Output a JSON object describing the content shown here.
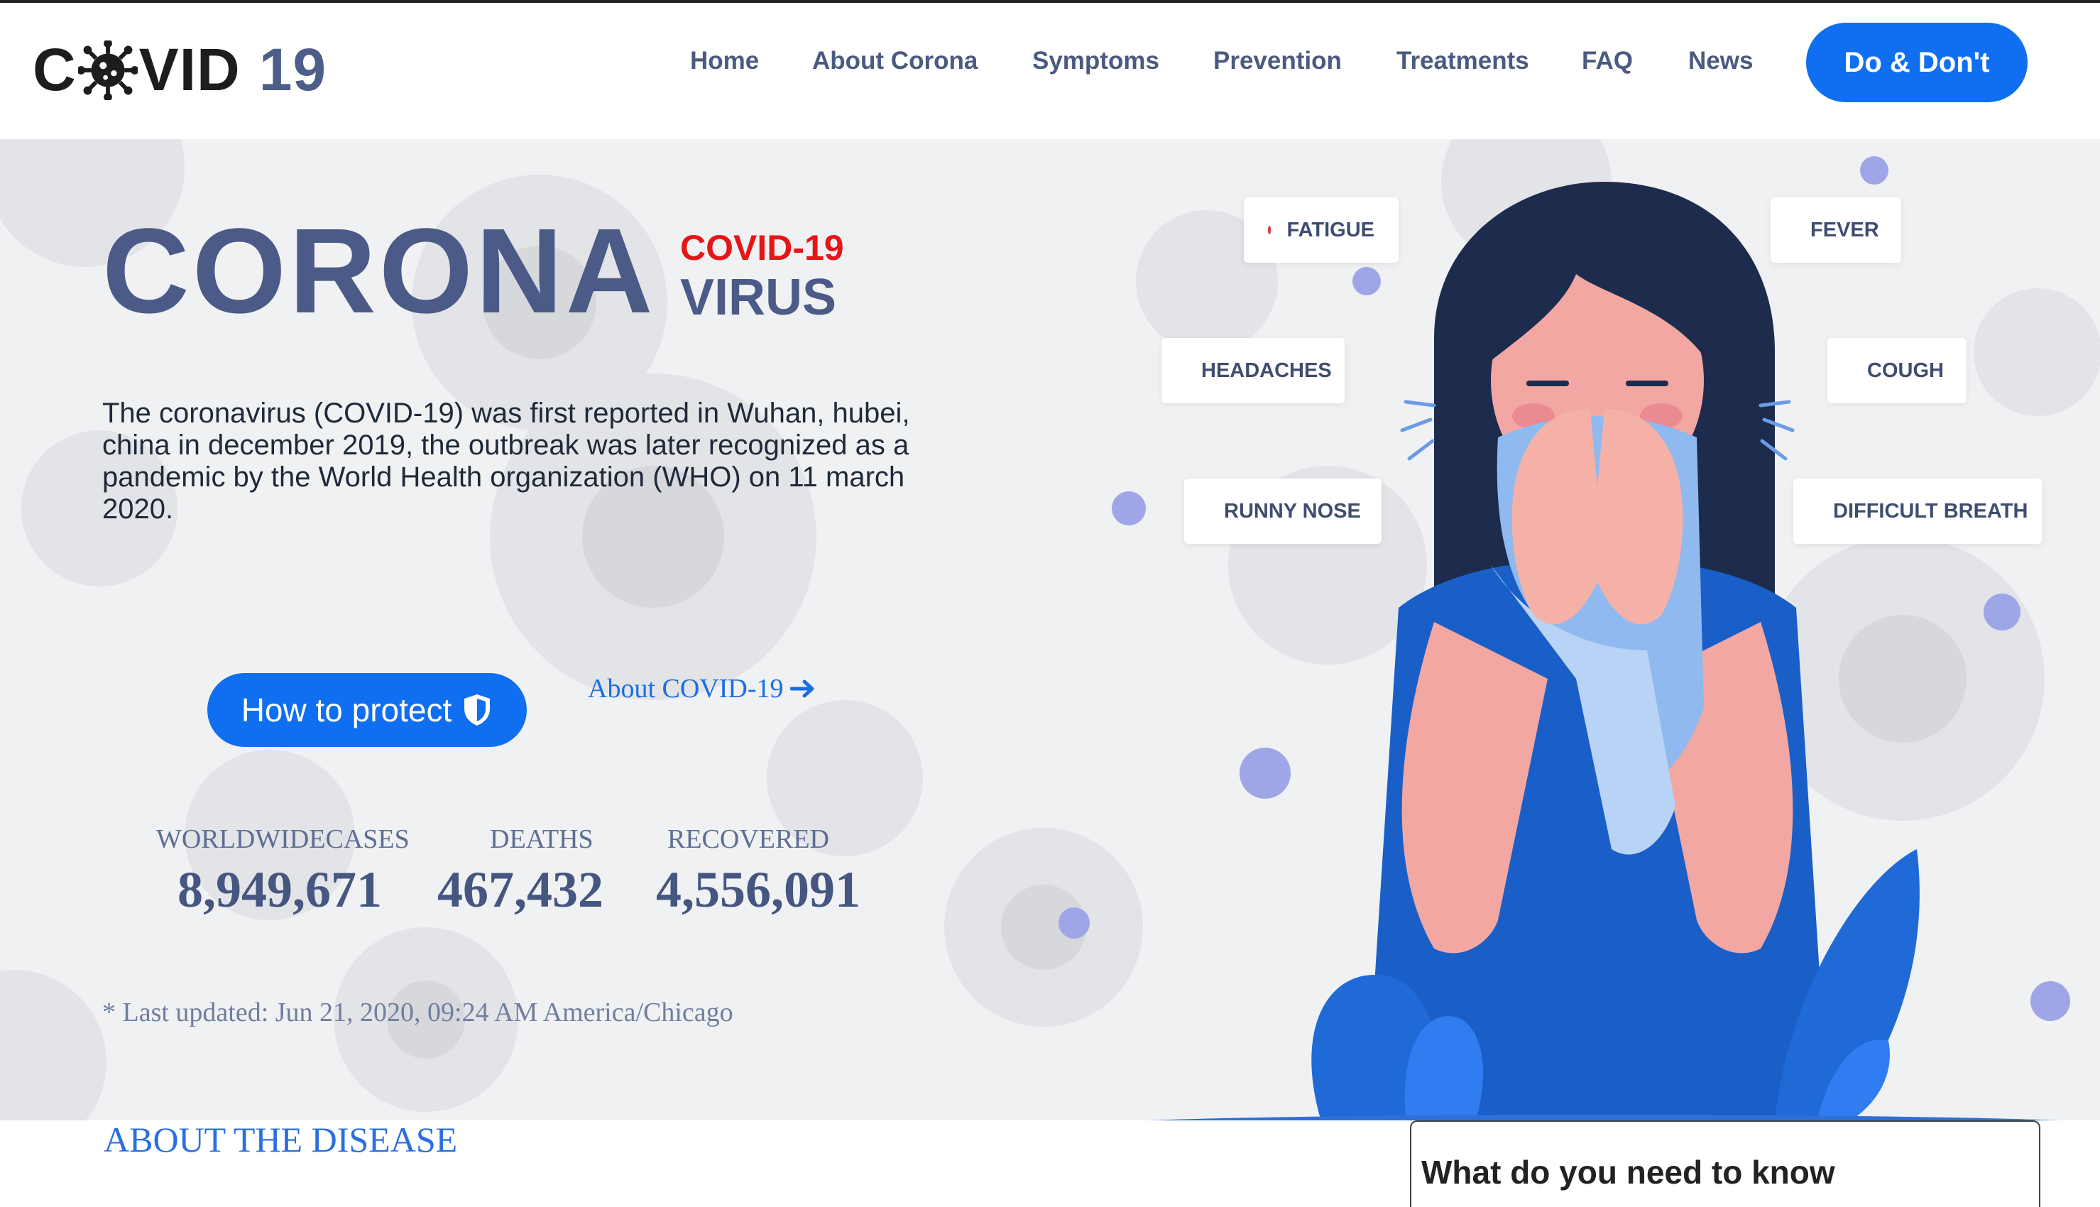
{
  "brand": {
    "logo_c": "C",
    "logo_vid": "VID",
    "logo_num": "19"
  },
  "nav": {
    "items": [
      {
        "label": "Home"
      },
      {
        "label": "About Corona"
      },
      {
        "label": "Symptoms"
      },
      {
        "label": "Prevention"
      },
      {
        "label": "Treatments"
      },
      {
        "label": "FAQ"
      },
      {
        "label": "News"
      }
    ],
    "cta_label": "Do & Don't"
  },
  "hero": {
    "title": "CORONA",
    "subtitle_top": "COVID-19",
    "subtitle_bottom": "VIRUS",
    "description": "The coronavirus (COVID-19) was first reported in Wuhan, hubei, china in december 2019, the outbreak was later recognized as a pandemic by the World Health organization (WHO) on 11 march 2020.",
    "protect_button": "How to protect",
    "about_link": "About COVID-19",
    "stats": [
      {
        "label": "WORLDWIDECASES",
        "value": "8,949,671"
      },
      {
        "label": "DEATHS",
        "value": "467,432"
      },
      {
        "label": "RECOVERED",
        "value": "4,556,091"
      }
    ],
    "updated": "* Last updated: Jun 21, 2020, 09:24 AM America/Chicago"
  },
  "symptoms": [
    "FATIGUE",
    "FEVER",
    "HEADACHES",
    "COUGH",
    "RUNNY NOSE",
    "DIFFICULT BREATH"
  ],
  "sections": {
    "about_disease": "ABOUT THE DISEASE",
    "know_title": "What do you need to know"
  },
  "colors": {
    "accent": "#0f6ff0",
    "title": "#4b5a87",
    "red": "#e51616",
    "symptom_dot": "#e5343b"
  },
  "icons": [
    "virus-icon",
    "shield-icon",
    "arrow-right-icon"
  ]
}
